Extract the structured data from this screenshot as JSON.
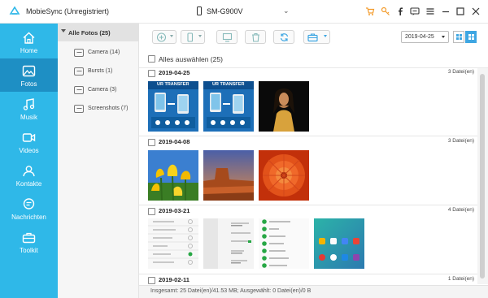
{
  "app": {
    "title": "MobieSync (Unregistriert)",
    "device": "SM-G900V",
    "accent": "#2fb8e8",
    "accent_dark": "#1e8fc4",
    "brand_orange": "#f39c2d",
    "icons": [
      "cart-icon",
      "key-icon",
      "facebook-icon",
      "chat-icon",
      "menu-icon",
      "minimize-icon",
      "maximize-icon",
      "close-icon"
    ]
  },
  "sidebar": {
    "items": [
      {
        "label": "Home",
        "icon": "home-icon"
      },
      {
        "label": "Fotos",
        "icon": "photo-icon",
        "active": true
      },
      {
        "label": "Musik",
        "icon": "music-icon"
      },
      {
        "label": "Videos",
        "icon": "video-icon"
      },
      {
        "label": "Kontakte",
        "icon": "contacts-icon"
      },
      {
        "label": "Nachrichten",
        "icon": "messages-icon"
      },
      {
        "label": "Toolkit",
        "icon": "toolkit-icon"
      }
    ]
  },
  "categories": {
    "header": "Alle Fotos (25)",
    "items": [
      {
        "label": "Camera (14)"
      },
      {
        "label": "Bursts (1)"
      },
      {
        "label": "Camera (3)"
      },
      {
        "label": "Screenshots (7)"
      }
    ]
  },
  "toolbar": {
    "buttons": [
      "add-button",
      "export-to-device-button",
      "export-to-pc-button",
      "delete-button",
      "refresh-button",
      "more-button"
    ],
    "date_filter": "2019-04-25"
  },
  "content": {
    "select_all": "Alles auswählen (25)",
    "groups": [
      {
        "date": "2019-04-25",
        "count": "3 Datei(en)"
      },
      {
        "date": "2019-04-08",
        "count": "3 Datei(en)"
      },
      {
        "date": "2019-03-21",
        "count": "4 Datei(en)"
      },
      {
        "date": "2019-02-11",
        "count": "1 Datei(en)"
      }
    ],
    "thumb_banner": "UR TRANSFER"
  },
  "status": {
    "text": "Insgesamt: 25 Datei(en)/41.53 MB; Ausgewählt: 0 Datei(en)/0 B"
  }
}
